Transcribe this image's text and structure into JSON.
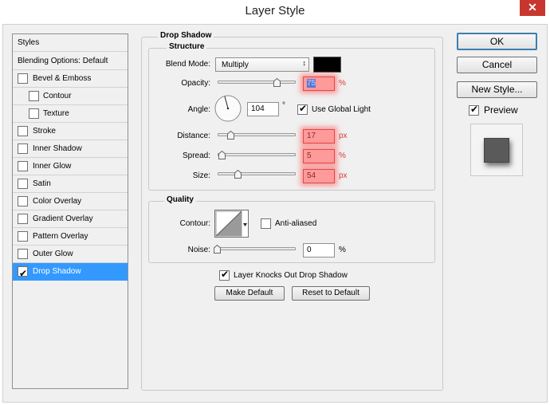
{
  "window": {
    "title": "Layer Style",
    "close_glyph": "✕"
  },
  "styles_list": {
    "header": "Styles",
    "blending": "Blending Options: Default",
    "items": [
      {
        "label": "Bevel & Emboss",
        "checked": false
      },
      {
        "label": "Contour",
        "checked": false
      },
      {
        "label": "Texture",
        "checked": false
      },
      {
        "label": "Stroke",
        "checked": false
      },
      {
        "label": "Inner Shadow",
        "checked": false
      },
      {
        "label": "Inner Glow",
        "checked": false
      },
      {
        "label": "Satin",
        "checked": false
      },
      {
        "label": "Color Overlay",
        "checked": false
      },
      {
        "label": "Gradient Overlay",
        "checked": false
      },
      {
        "label": "Pattern Overlay",
        "checked": false
      },
      {
        "label": "Outer Glow",
        "checked": false
      },
      {
        "label": "Drop Shadow",
        "checked": true,
        "selected": true
      }
    ]
  },
  "drop_shadow": {
    "title": "Drop Shadow",
    "structure": {
      "title": "Structure",
      "blend_mode_label": "Blend Mode:",
      "blend_mode_value": "Multiply",
      "shadow_color": "#000000",
      "opacity_label": "Opacity:",
      "opacity_value": "75",
      "opacity_unit": "%",
      "angle_label": "Angle:",
      "angle_value": "104",
      "angle_unit": "°",
      "use_global_light_label": "Use Global Light",
      "use_global_light": true,
      "distance_label": "Distance:",
      "distance_value": "17",
      "distance_unit": "px",
      "spread_label": "Spread:",
      "spread_value": "5",
      "spread_unit": "%",
      "size_label": "Size:",
      "size_value": "54",
      "size_unit": "px"
    },
    "quality": {
      "title": "Quality",
      "contour_label": "Contour:",
      "anti_aliased_label": "Anti-aliased",
      "anti_aliased": false,
      "noise_label": "Noise:",
      "noise_value": "0",
      "noise_unit": "%"
    },
    "layer_knocks_out_label": "Layer Knocks Out Drop Shadow",
    "layer_knocks_out": true,
    "make_default_label": "Make Default",
    "reset_default_label": "Reset to Default"
  },
  "buttons": {
    "ok": "OK",
    "cancel": "Cancel",
    "new_style": "New Style...",
    "preview_label": "Preview",
    "preview_checked": true
  }
}
